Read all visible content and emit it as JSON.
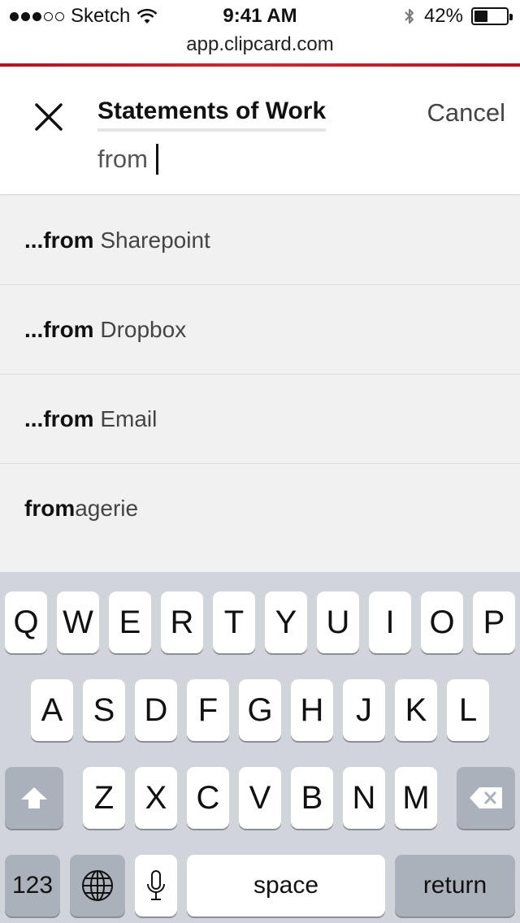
{
  "status_bar": {
    "carrier": "Sketch",
    "time": "9:41 AM",
    "battery": "42%",
    "battery_level": 0.42,
    "signal_bars_filled": 3,
    "signal_bars_total": 5
  },
  "browser": {
    "url": "app.clipcard.com",
    "accent_color": "#c0161e"
  },
  "search": {
    "scope_title": "Statements of Work",
    "query": "from",
    "cancel_label": "Cancel"
  },
  "suggestions": [
    {
      "prefix": "...",
      "match": "from",
      "rest": " Sharepoint"
    },
    {
      "prefix": "...",
      "match": "from",
      "rest": " Dropbox"
    },
    {
      "prefix": "...",
      "match": "from",
      "rest": " Email"
    },
    {
      "prefix": "",
      "match": "from",
      "rest": "agerie"
    }
  ],
  "keyboard": {
    "row1": [
      "Q",
      "W",
      "E",
      "R",
      "T",
      "Y",
      "U",
      "I",
      "O",
      "P"
    ],
    "row2": [
      "A",
      "S",
      "D",
      "F",
      "G",
      "H",
      "J",
      "K",
      "L"
    ],
    "row3": [
      "Z",
      "X",
      "C",
      "V",
      "B",
      "N",
      "M"
    ],
    "numbers_label": "123",
    "space_label": "space",
    "return_label": "return",
    "icons": {
      "shift": "shift-icon",
      "delete": "backspace-icon",
      "globe": "globe-icon",
      "dictation": "microphone-icon"
    }
  }
}
